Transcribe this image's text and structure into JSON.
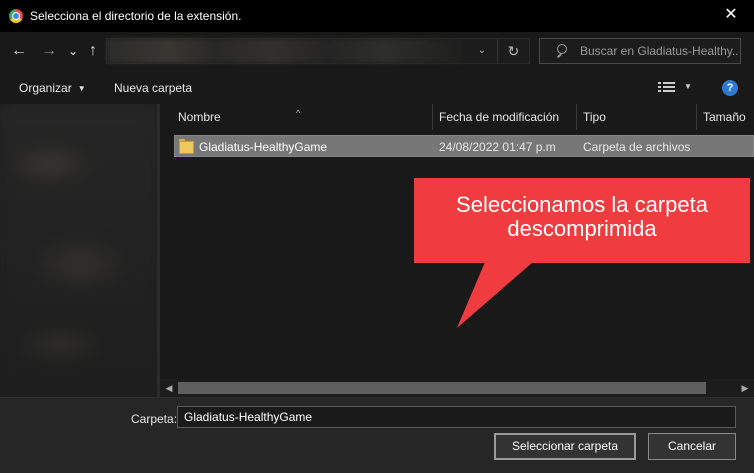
{
  "window": {
    "title": "Selecciona el directorio de la extensión.",
    "close_glyph": "✕"
  },
  "nav": {
    "back_glyph": "←",
    "forward_glyph": "→",
    "recent_glyph": "⌄",
    "up_glyph": "↑",
    "dropdown_glyph": "⌄",
    "refresh_glyph": "↻",
    "search_placeholder": "Buscar en Gladiatus-Healthy..."
  },
  "toolbar": {
    "organize_label": "Organizar",
    "organize_caret": "▼",
    "new_folder_label": "Nueva carpeta",
    "view_caret": "▼",
    "help_glyph": "?"
  },
  "columns": {
    "name": "Nombre",
    "modified": "Fecha de modificación",
    "type": "Tipo",
    "size": "Tamaño",
    "sort_glyph": "^"
  },
  "files": [
    {
      "name": "Gladiatus-HealthyGame",
      "modified": "24/08/2022 01:47 p.m",
      "type": "Carpeta de archivos",
      "icon": "folder-icon",
      "selected": true
    }
  ],
  "callout": {
    "line1": "Seleccionamos la carpeta",
    "line2": "descomprimida",
    "color": "#f03c3f"
  },
  "scrollbar": {
    "left_glyph": "◀",
    "right_glyph": "▶"
  },
  "footer": {
    "folder_label": "Carpeta:",
    "folder_value": "Gladiatus-HealthyGame",
    "select_button": "Seleccionar carpeta",
    "cancel_button": "Cancelar"
  },
  "colors": {
    "accent_help": "#2e7ad1",
    "selection": "#777777",
    "background": "#191919"
  }
}
